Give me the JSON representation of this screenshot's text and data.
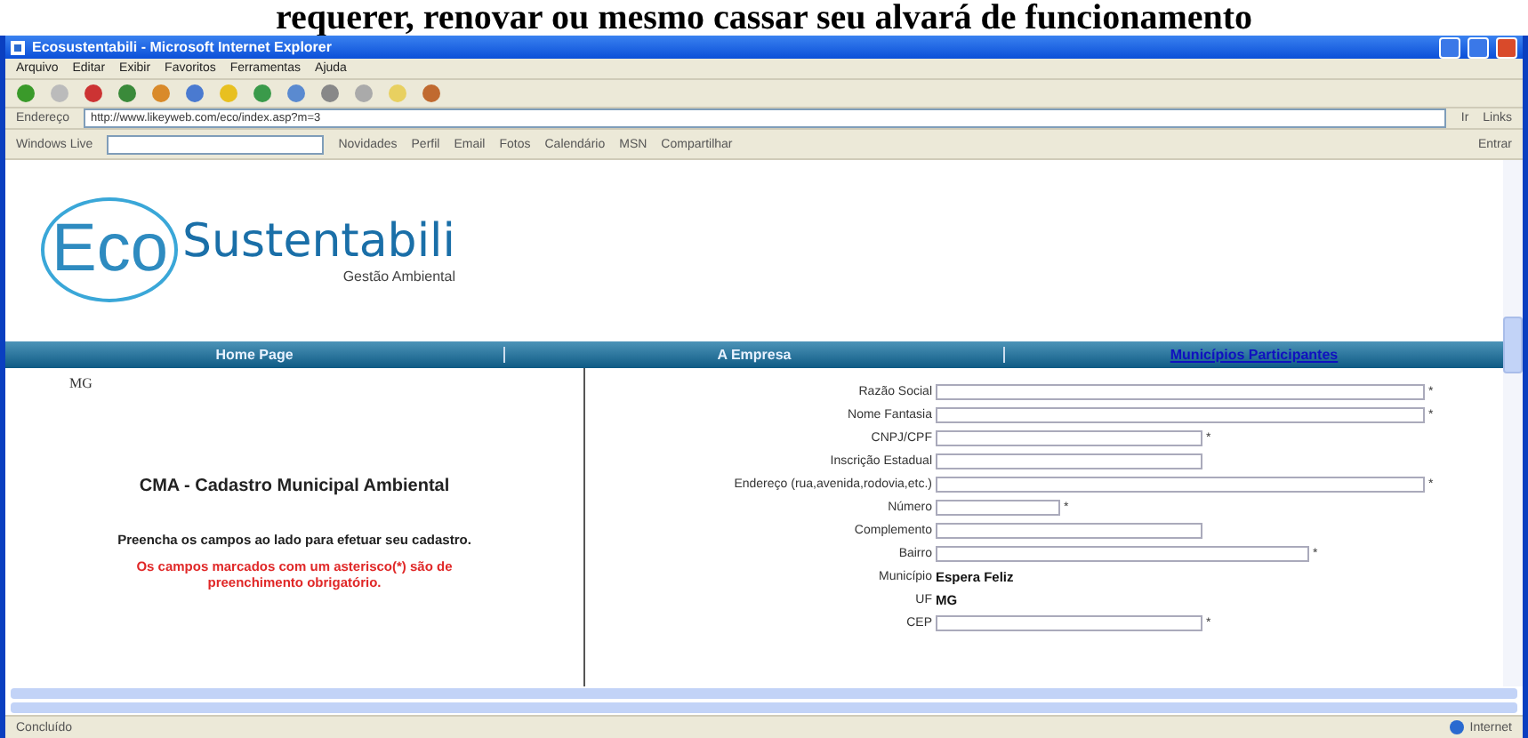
{
  "caption": "requerer, renovar ou mesmo cassar seu alvará de funcionamento",
  "window": {
    "title": "Ecosustentabili - Microsoft Internet Explorer"
  },
  "menu": [
    "Arquivo",
    "Editar",
    "Exibir",
    "Favoritos",
    "Ferramentas",
    "Ajuda"
  ],
  "address": {
    "label": "Endereço",
    "value": "http://www.likeyweb.com/eco/index.asp?m=3",
    "go": "Ir",
    "links": "Links"
  },
  "live_bar": {
    "brand": "Windows Live",
    "items": [
      "Novidades",
      "Perfil",
      "Email",
      "Fotos",
      "Calendário",
      "MSN",
      "Compartilhar"
    ],
    "signin": "Entrar"
  },
  "logo": {
    "mark": "Eco",
    "name": "Sustentabili",
    "tagline": "Gestão Ambiental"
  },
  "nav": [
    {
      "label": "Home Page",
      "selected": false
    },
    {
      "label": "A Empresa",
      "selected": false
    },
    {
      "label": "Municípios Participantes",
      "selected": true
    }
  ],
  "left": {
    "state": "MG",
    "heading": "CMA - Cadastro Municipal Ambiental",
    "instruction": "Preencha os campos ao lado para efetuar seu cadastro.",
    "note": "Os campos marcados com um asterisco(*) são de preenchimento obrigatório."
  },
  "form": [
    {
      "label": "Razão Social",
      "kind": "long",
      "mark": "*"
    },
    {
      "label": "Nome Fantasia",
      "kind": "long",
      "mark": "*"
    },
    {
      "label": "CNPJ/CPF",
      "kind": "medium",
      "mark": "*"
    },
    {
      "label": "Inscrição Estadual",
      "kind": "medium"
    },
    {
      "label": "Endereço (rua,avenida,rodovia,etc.)",
      "kind": "long",
      "mark": "*"
    },
    {
      "label": "Número",
      "kind": "short",
      "mark": "*"
    },
    {
      "label": "Complemento",
      "kind": "medium"
    },
    {
      "label": "Bairro",
      "kind": "wide",
      "mark": "*"
    },
    {
      "label": "Município",
      "kind": "value",
      "value": "Espera Feliz"
    },
    {
      "label": "UF",
      "kind": "value",
      "value": "MG"
    },
    {
      "label": "CEP",
      "kind": "medium",
      "mark": "*"
    }
  ],
  "status": {
    "text": "Concluído",
    "zone": "Internet"
  }
}
